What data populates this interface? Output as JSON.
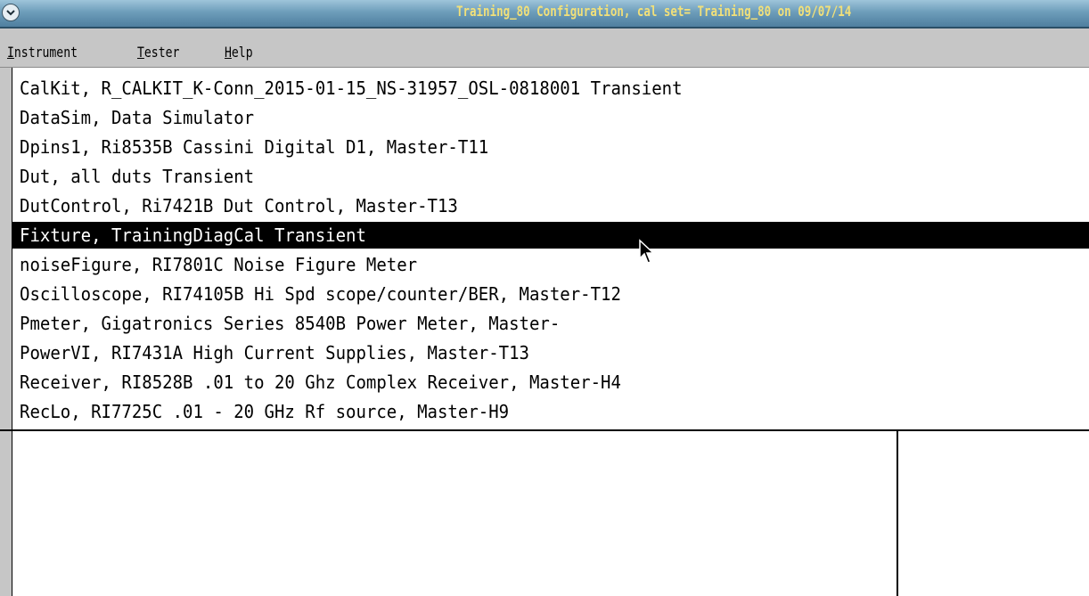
{
  "window": {
    "title": "Training_80 Configuration,  cal set= Training_80 on 09/07/14",
    "menu_icon": "chevron-down-icon"
  },
  "menubar": {
    "items": [
      {
        "mnemonic": "I",
        "rest": "nstrument"
      },
      {
        "mnemonic": "T",
        "rest": "ester"
      },
      {
        "mnemonic": "H",
        "rest": "elp"
      }
    ]
  },
  "instrument_list": {
    "selected_index": 5,
    "items": [
      "CalKit,  R_CALKIT_K-Conn_2015-01-15_NS-31957_OSL-0818001 Transient",
      "DataSim,  Data Simulator",
      "Dpins1,  Ri8535B Cassini Digital D1, Master-T11",
      "Dut,  all duts Transient",
      "DutControl,  Ri7421B Dut Control, Master-T13",
      "Fixture,  TrainingDiagCal Transient",
      "noiseFigure,  RI7801C Noise Figure Meter",
      "Oscilloscope,  RI74105B Hi Spd scope/counter/BER, Master-T12",
      "Pmeter,  Gigatronics Series 8540B Power Meter, Master-",
      "PowerVI,  RI7431A High Current Supplies, Master-T13",
      "Receiver,  RI8528B   .01 to 20 Ghz Complex Receiver, Master-H4",
      "RecLo,  RI7725C .01 - 20 GHz Rf source, Master-H9"
    ]
  },
  "colors": {
    "selection_bg": "#000000",
    "selection_fg": "#ffffff",
    "title_text": "#f1e07a"
  }
}
